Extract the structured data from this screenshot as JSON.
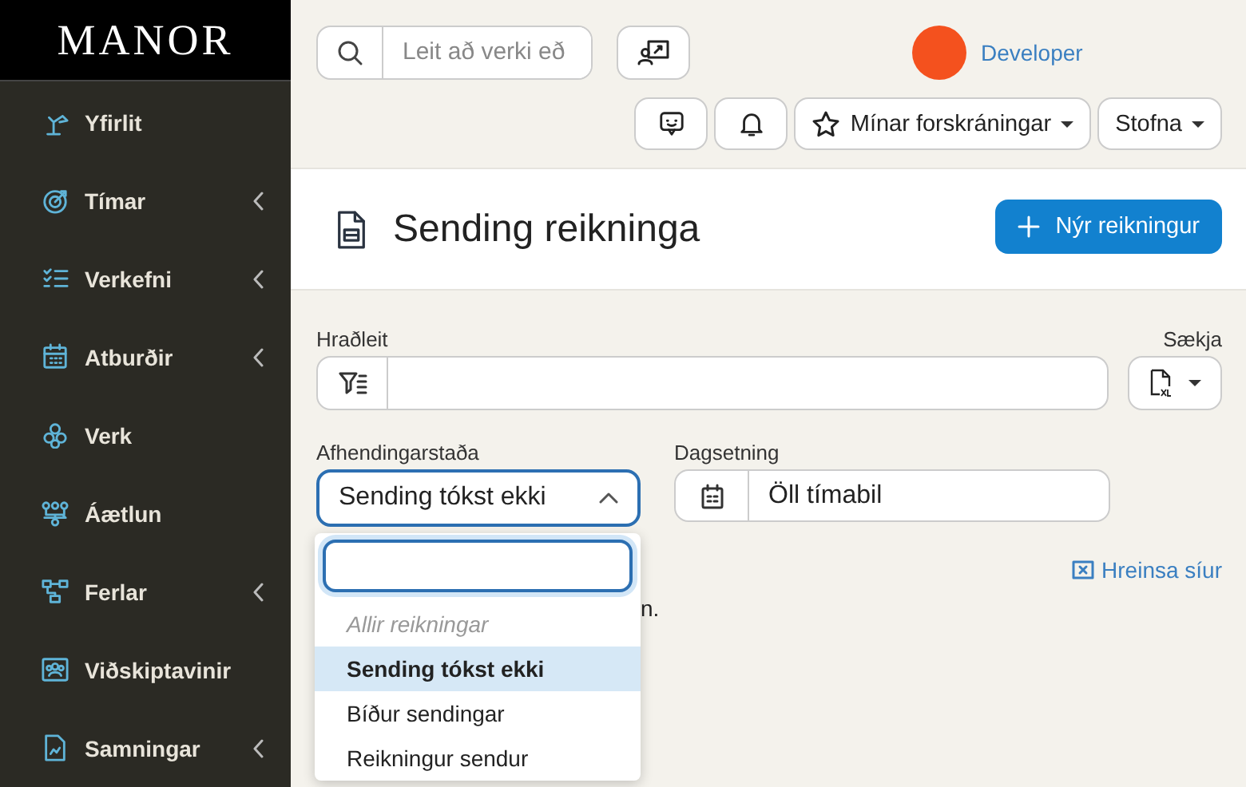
{
  "sidebar": {
    "logo": "MANOR",
    "items": [
      {
        "label": "Yfirlit",
        "expandable": false
      },
      {
        "label": "Tímar",
        "expandable": true
      },
      {
        "label": "Verkefni",
        "expandable": true
      },
      {
        "label": "Atburðir",
        "expandable": true
      },
      {
        "label": "Verk",
        "expandable": false
      },
      {
        "label": "Áætlun",
        "expandable": false
      },
      {
        "label": "Ferlar",
        "expandable": true
      },
      {
        "label": "Viðskiptavinir",
        "expandable": false
      },
      {
        "label": "Samningar",
        "expandable": true
      }
    ]
  },
  "topbar": {
    "search": {
      "placeholder": "Leit að verki eð"
    },
    "user": {
      "name": "Developer",
      "color": "#f4511e"
    },
    "buttons": [
      {
        "kind": "icon"
      },
      {
        "kind": "icon"
      },
      {
        "kind": "menu",
        "label": "Mínar forskráningar"
      },
      {
        "kind": "menu",
        "label": "Stofna"
      }
    ]
  },
  "header": {
    "title": "Sending reikninga",
    "action": "Nýr reikningur"
  },
  "filters": {
    "quick_search": {
      "label": "Hraðleit"
    },
    "download": {
      "label": "Sækja"
    },
    "status": {
      "label": "Afhendingarstaða",
      "value": "Sending tókst ekki",
      "expanded": true
    },
    "date": {
      "label": "Dagsetning",
      "value": "Öll tímabil"
    },
    "clear": "Hreinsa síur"
  },
  "results_text": "n.",
  "dropdown": {
    "options": [
      {
        "label": "Allir reikningar",
        "kind": "placeholder",
        "selected": false
      },
      {
        "label": "Sending tókst ekki",
        "kind": "option",
        "selected": true
      },
      {
        "label": "Bíður sendingar",
        "kind": "option",
        "selected": false
      },
      {
        "label": "Reikningur sendur",
        "kind": "option",
        "selected": false
      }
    ]
  }
}
